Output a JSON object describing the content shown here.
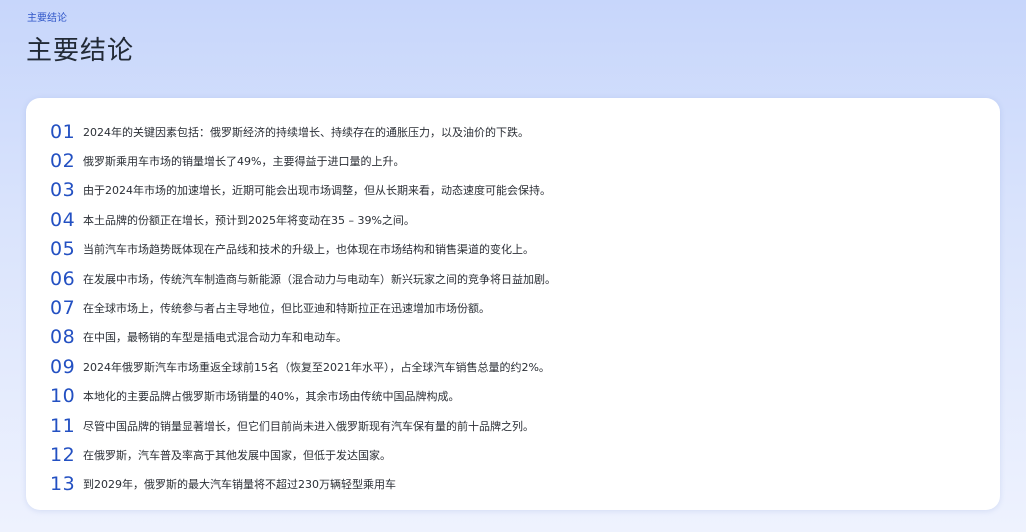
{
  "header": {
    "eyebrow": "主要结论",
    "title": "主要结论"
  },
  "conclusions": [
    {
      "num": "01",
      "text": "2024年的关键因素包括：俄罗斯经济的持续增长、持续存在的通胀压力，以及油价的下跌。"
    },
    {
      "num": "02",
      "text": "俄罗斯乘用车市场的销量增长了49%，主要得益于进口量的上升。"
    },
    {
      "num": "03",
      "text": "由于2024年市场的加速增长，近期可能会出现市场调整，但从长期来看，动态速度可能会保持。"
    },
    {
      "num": "04",
      "text": "本土品牌的份额正在增长，预计到2025年将变动在35 – 39%之间。"
    },
    {
      "num": "05",
      "text": "当前汽车市场趋势既体现在产品线和技术的升级上，也体现在市场结构和销售渠道的变化上。"
    },
    {
      "num": "06",
      "text": "在发展中市场，传统汽车制造商与新能源（混合动力与电动车）新兴玩家之间的竞争将日益加剧。"
    },
    {
      "num": "07",
      "text": "在全球市场上，传统参与者占主导地位，但比亚迪和特斯拉正在迅速增加市场份额。"
    },
    {
      "num": "08",
      "text": "在中国，最畅销的车型是插电式混合动力车和电动车。"
    },
    {
      "num": "09",
      "text": "2024年俄罗斯汽车市场重返全球前15名（恢复至2021年水平），占全球汽车销售总量的约2%。"
    },
    {
      "num": "10",
      "text": "本地化的主要品牌占俄罗斯市场销量的40%，其余市场由传统中国品牌构成。"
    },
    {
      "num": "11",
      "text": "尽管中国品牌的销量显著增长，但它们目前尚未进入俄罗斯现有汽车保有量的前十品牌之列。"
    },
    {
      "num": "12",
      "text": "在俄罗斯，汽车普及率高于其他发展中国家，但低于发达国家。"
    },
    {
      "num": "13",
      "text": "到2029年，俄罗斯的最大汽车销量将不超过230万辆轻型乘用车"
    }
  ]
}
